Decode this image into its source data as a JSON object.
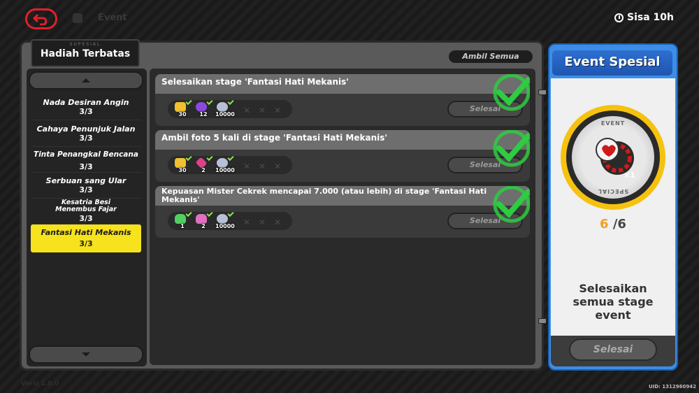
{
  "top_bar": {
    "back_icon": "back-arrow-icon",
    "ghost_label": "Event",
    "timer_icon": "clock-icon",
    "timer_text": "Sisa 10h"
  },
  "panel": {
    "title_sub": "SUPESIAL",
    "title": "Hadiah Terbatas",
    "claim_all_label": "Ambil Semua"
  },
  "stages": [
    {
      "name": "Nada Desiran Angin",
      "count": "3/3",
      "selected": false
    },
    {
      "name": "Cahaya Penunjuk Jalan",
      "count": "3/3",
      "selected": false
    },
    {
      "name": "Tinta Penangkal Bencana",
      "count": "3/3",
      "selected": false
    },
    {
      "name": "Serbuan sang Ular",
      "count": "3/3",
      "selected": false
    },
    {
      "name": "Kesatria Besi Menembus Fajar",
      "count": "3/3",
      "selected": false
    },
    {
      "name": "Fantasi Hati Mekanis",
      "count": "3/3",
      "selected": true
    }
  ],
  "tasks": [
    {
      "title": "Selesaikan stage 'Fantasi Hati Mekanis'",
      "button": "Selesai",
      "rewards": [
        {
          "icon": "stamina-orb-icon",
          "amount": "30",
          "color": "#f0c030"
        },
        {
          "icon": "purple-crystal-icon",
          "amount": "12",
          "color": "#8a4adf"
        },
        {
          "icon": "coin-pile-icon",
          "amount": "10000",
          "color": "#b8c0d8"
        }
      ]
    },
    {
      "title": "Ambil foto 5 kali di stage 'Fantasi Hati Mekanis'",
      "button": "Selesai",
      "rewards": [
        {
          "icon": "stamina-orb-icon",
          "amount": "30",
          "color": "#f0c030"
        },
        {
          "icon": "pink-crystal-icon",
          "amount": "2",
          "color": "#e0408a"
        },
        {
          "icon": "coin-pile-icon",
          "amount": "10000",
          "color": "#b8c0d8"
        }
      ]
    },
    {
      "title": "Kepuasan Mister Cekrek mencapai 7.000 (atau lebih) di stage 'Fantasi Hati Mekanis'",
      "button": "Selesai",
      "rewards": [
        {
          "icon": "green-potion-icon",
          "amount": "1",
          "color": "#50d060"
        },
        {
          "icon": "pink-potion-icon",
          "amount": "2",
          "color": "#e070c0"
        },
        {
          "icon": "coin-pile-icon",
          "amount": "10000",
          "color": "#b8c0d8"
        }
      ]
    }
  ],
  "event": {
    "title": "Event Spesial",
    "medal_top": "EVENT",
    "medal_bottom": "SPECIAL",
    "medal_qty": "×1",
    "progress_current": "6",
    "progress_total": "/6",
    "description": "Selesaikan semua stage event",
    "button": "Selesai"
  },
  "footer": {
    "uid": "UID: 1312960942",
    "ghost_left": "Versi 1.0.0"
  }
}
